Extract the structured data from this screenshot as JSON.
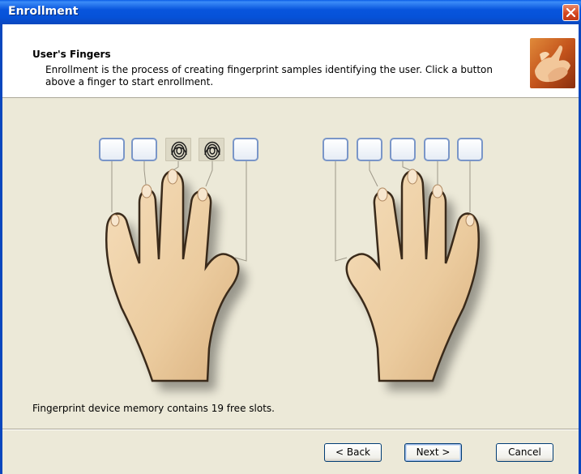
{
  "window": {
    "title": "Enrollment"
  },
  "header": {
    "title": "User's Fingers",
    "description": "Enrollment is the process of creating fingerprint samples identifying the user. Click a button above a finger to start enrollment."
  },
  "hands": {
    "left": [
      {
        "finger": "little",
        "enrolled": false
      },
      {
        "finger": "ring",
        "enrolled": false
      },
      {
        "finger": "middle",
        "enrolled": true
      },
      {
        "finger": "index",
        "enrolled": true
      },
      {
        "finger": "thumb",
        "enrolled": false
      }
    ],
    "right": [
      {
        "finger": "thumb",
        "enrolled": false
      },
      {
        "finger": "index",
        "enrolled": false
      },
      {
        "finger": "middle",
        "enrolled": false
      },
      {
        "finger": "ring",
        "enrolled": false
      },
      {
        "finger": "little",
        "enrolled": false
      }
    ]
  },
  "status": {
    "text": "Fingerprint device memory contains 19 free slots."
  },
  "buttons": {
    "back": "< Back",
    "next": "Next >",
    "cancel": "Cancel"
  },
  "colors": {
    "titlebar": "#0855DD",
    "dialog": "#ECE9D8",
    "skin": "#EED0A6",
    "close": "#D5471F"
  }
}
